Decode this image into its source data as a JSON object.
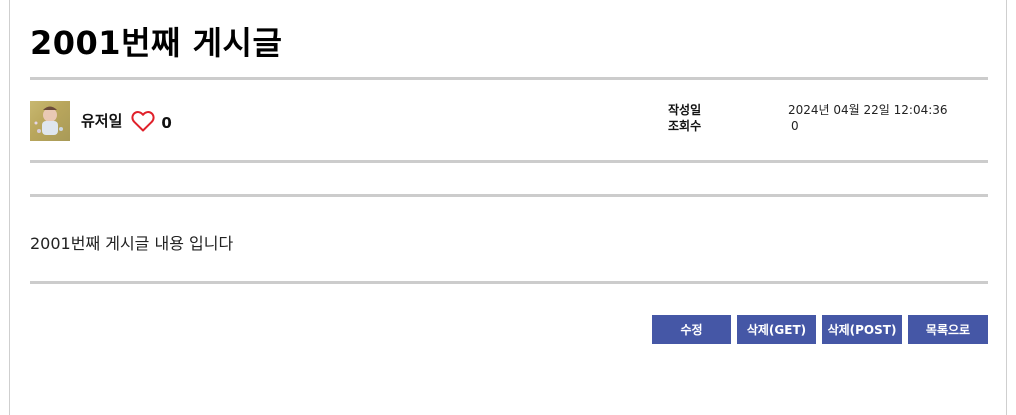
{
  "post": {
    "title": "2001번째 게시글",
    "writer": "유저일",
    "like_count": "0",
    "created_label": "작성일",
    "created_value": "2024년 04월 22일 12:04:36",
    "views_label": "조회수",
    "views_value": "0",
    "content": "2001번째 게시글 내용 입니다"
  },
  "icons": {
    "avatar": "user-avatar-image",
    "like": "heart-outline-icon"
  },
  "colors": {
    "button_bg": "#4557a6",
    "divider": "#cccccc",
    "heart": "#e0202a"
  },
  "actions": {
    "edit_label": "수정",
    "delete_get_label": "삭제(GET)",
    "delete_post_label": "삭제(POST)",
    "list_label": "목록으로"
  }
}
